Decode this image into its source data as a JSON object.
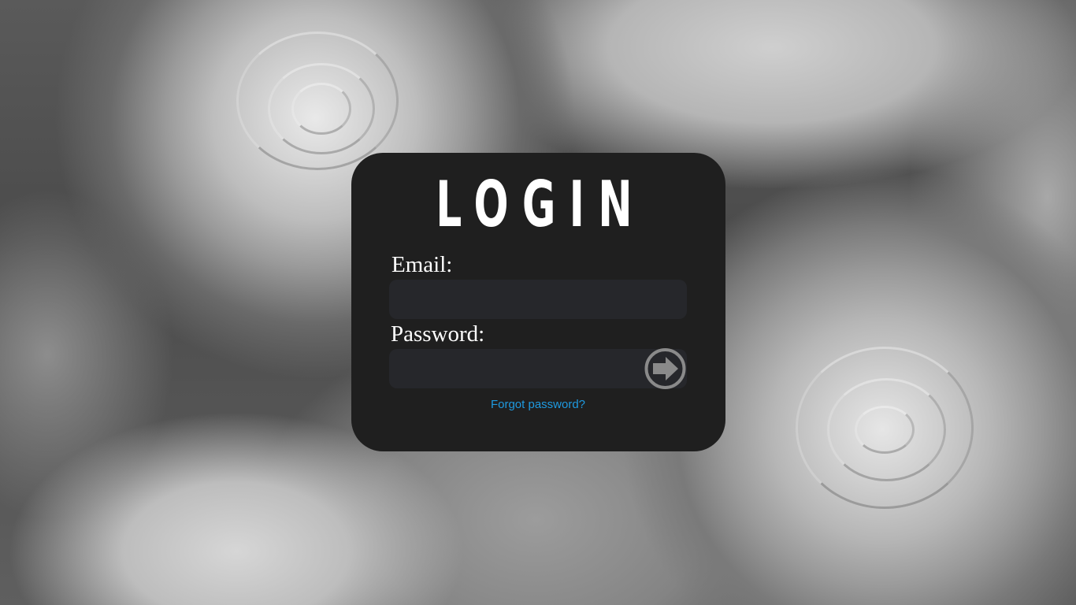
{
  "login_card": {
    "title": "LOGIN",
    "email_label": "Email:",
    "email_value": "",
    "password_label": "Password:",
    "password_value": "",
    "forgot_password_link": "Forgot password?",
    "submit_icon": "arrow-right-circle-icon"
  },
  "colors": {
    "card_background": "#1f1f1f",
    "input_background": "#26272b",
    "link": "#1f9ae0",
    "submit_icon": "#8a8a8a"
  }
}
